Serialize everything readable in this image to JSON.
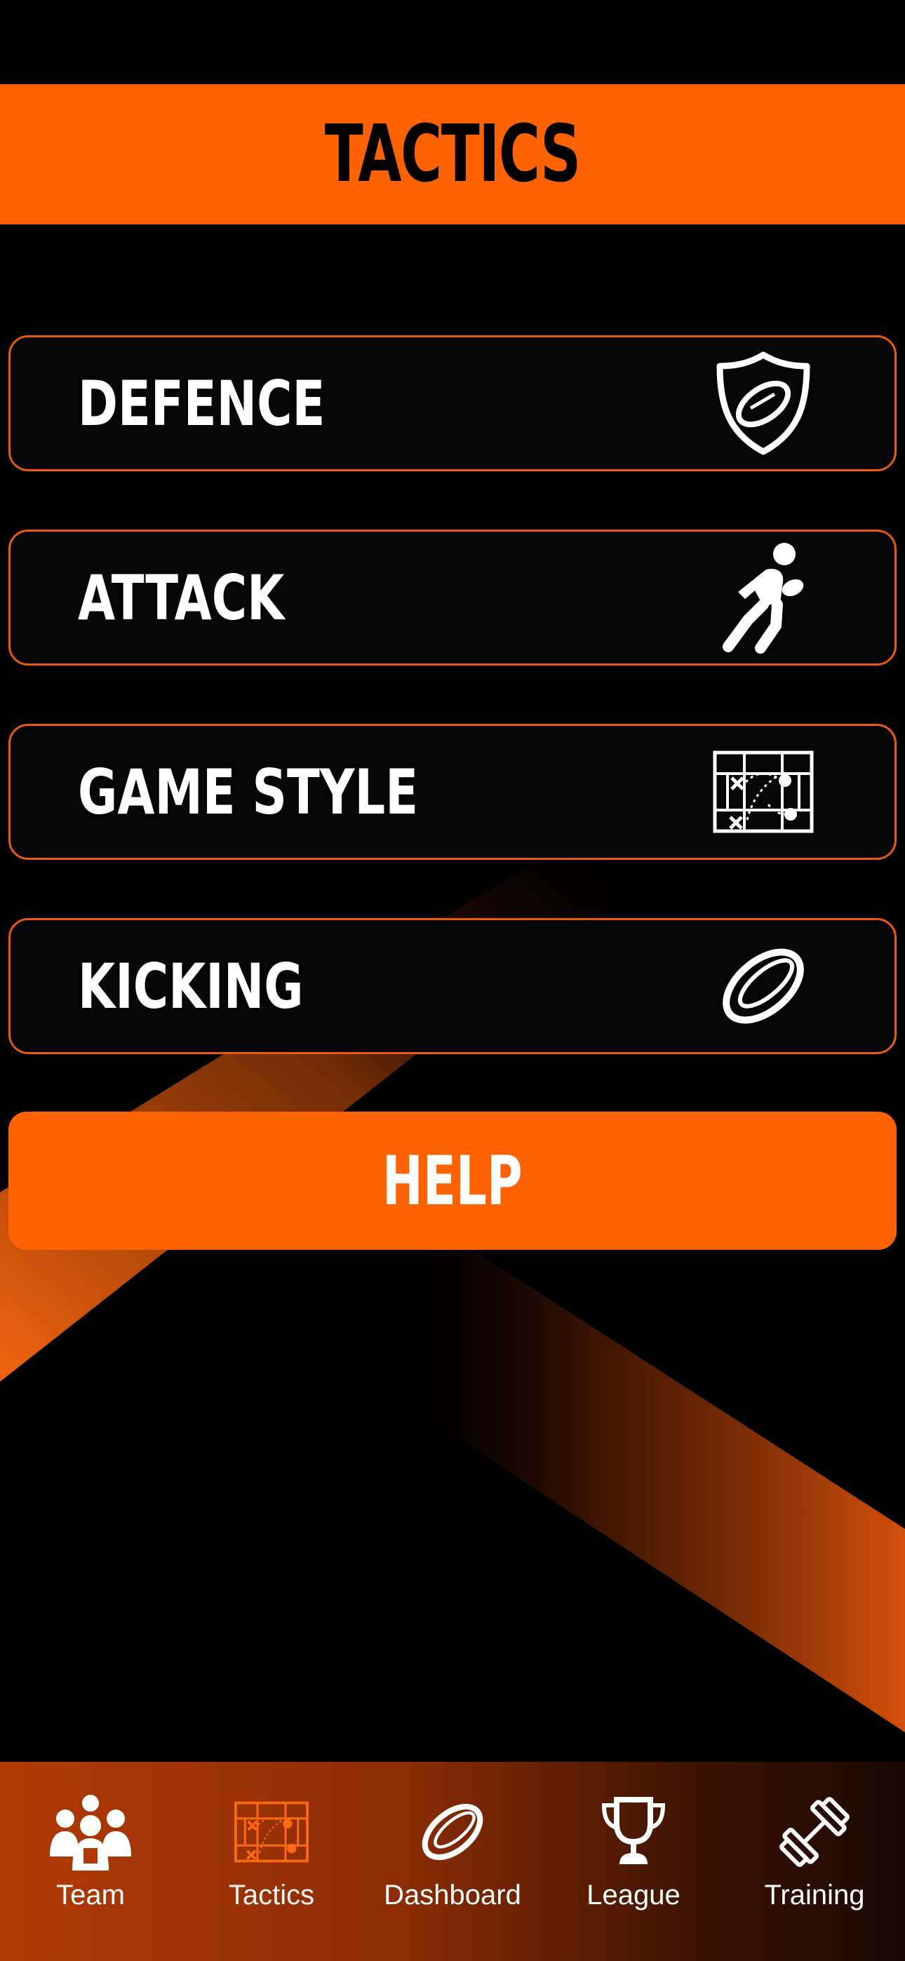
{
  "header": {
    "title": "TACTICS"
  },
  "menu": {
    "items": [
      {
        "label": "DEFENCE",
        "icon": "shield-ball-icon"
      },
      {
        "label": "ATTACK",
        "icon": "runner-with-ball-icon"
      },
      {
        "label": "GAME STYLE",
        "icon": "tactics-board-icon"
      },
      {
        "label": "KICKING",
        "icon": "rugby-ball-icon"
      }
    ]
  },
  "help": {
    "label": "HELP"
  },
  "tabbar": {
    "items": [
      {
        "label": "Team",
        "icon": "team-icon",
        "active": false
      },
      {
        "label": "Tactics",
        "icon": "tactics-board-icon",
        "active": true
      },
      {
        "label": "Dashboard",
        "icon": "rugby-ball-icon",
        "active": false
      },
      {
        "label": "League",
        "icon": "trophy-icon",
        "active": false
      },
      {
        "label": "Training",
        "icon": "dumbbell-icon",
        "active": false
      }
    ]
  },
  "colors": {
    "accent": "#ff6200",
    "background": "#000000",
    "border": "#e85a0c"
  }
}
